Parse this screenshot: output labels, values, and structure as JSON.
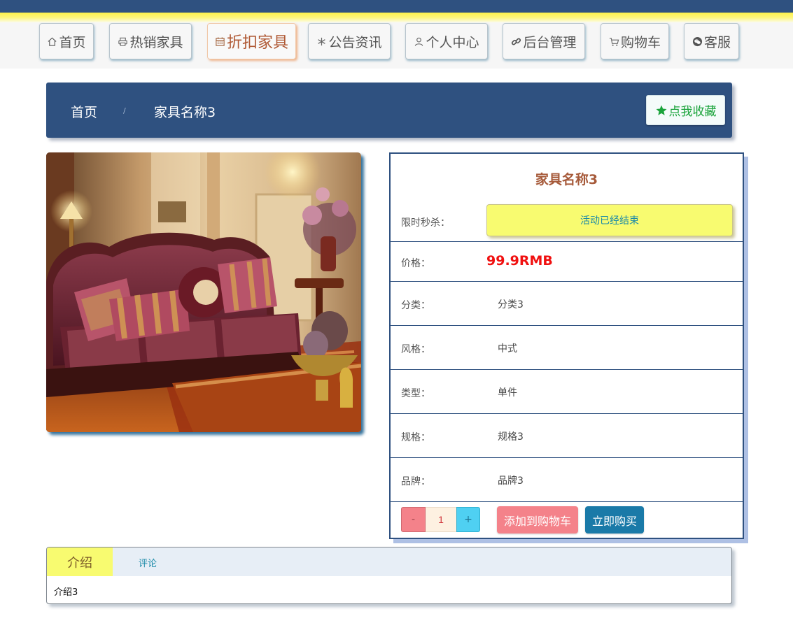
{
  "nav": {
    "items": [
      {
        "label": "首页",
        "icon": "home-icon"
      },
      {
        "label": "热销家具",
        "icon": "print-icon"
      },
      {
        "label": "折扣家具",
        "icon": "calendar-icon"
      },
      {
        "label": "公告资讯",
        "icon": "snowflake-icon"
      },
      {
        "label": "个人中心",
        "icon": "user-icon"
      },
      {
        "label": "后台管理",
        "icon": "link-icon"
      },
      {
        "label": "购物车",
        "icon": "cart-icon"
      },
      {
        "label": "客服",
        "icon": "wechat-icon"
      }
    ],
    "active_index": 2
  },
  "breadcrumb": {
    "home": "首页",
    "separator": "/",
    "current": "家具名称3"
  },
  "favorite": {
    "label": "点我收藏",
    "icon": "star-icon"
  },
  "product": {
    "image_icon": "sofa-photo",
    "title": "家具名称3",
    "promo_label": "限时秒杀：",
    "promo_status": "活动已经结束",
    "price_label": "价格：",
    "price": "99.9RMB",
    "attrs": [
      {
        "label": "分类：",
        "value": "分类3"
      },
      {
        "label": "风格：",
        "value": "中式"
      },
      {
        "label": "类型：",
        "value": "单件"
      },
      {
        "label": "规格：",
        "value": "规格3"
      },
      {
        "label": "品牌：",
        "value": "品牌3"
      }
    ]
  },
  "purchase": {
    "minus": "-",
    "quantity": "1",
    "plus": "+",
    "add_to_cart": "添加到购物车",
    "buy_now": "立即购买"
  },
  "tabs": {
    "intro_label": "介绍",
    "comment_label": "评论",
    "content": "介绍3"
  },
  "colors": {
    "header_blue": "#2f5180",
    "promo_yellow": "#f8fb70",
    "price_red": "#f01010",
    "favorite_green": "#19a33a",
    "cart_pink": "#f4828a",
    "buy_blue": "#1a7aa8"
  }
}
